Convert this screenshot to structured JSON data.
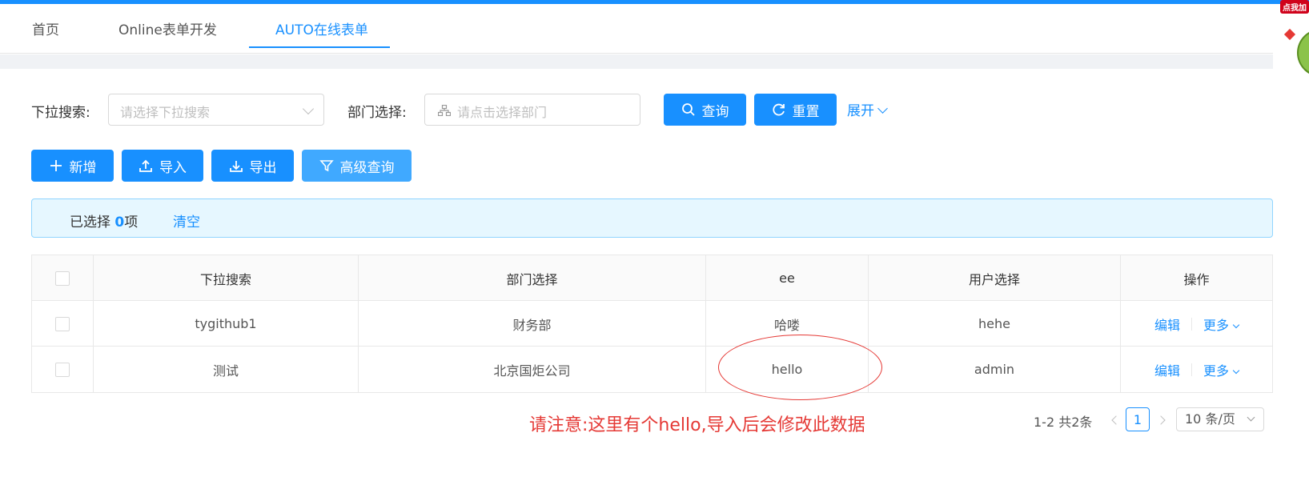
{
  "colors": {
    "primary": "#1890ff",
    "alert_bg": "#e6f7ff",
    "note_red": "#e53935"
  },
  "tabs": [
    {
      "label": "首页",
      "active": false
    },
    {
      "label": "Online表单开发",
      "active": false
    },
    {
      "label": "AUTO在线表单",
      "active": true
    }
  ],
  "search": {
    "dropdown_label": "下拉搜索:",
    "dropdown_placeholder": "请选择下拉搜索",
    "dept_label": "部门选择:",
    "dept_placeholder": "请点击选择部门",
    "query_button": "查询",
    "reset_button": "重置",
    "expand_link": "展开"
  },
  "toolbar": {
    "add": "新增",
    "import": "导入",
    "export": "导出",
    "advanced_query": "高级查询"
  },
  "selection": {
    "prefix": "已选择",
    "count": "0",
    "suffix": "项",
    "clear": "清空"
  },
  "table": {
    "columns": [
      "下拉搜索",
      "部门选择",
      "ee",
      "用户选择",
      "操作"
    ],
    "rows": [
      {
        "dropdown": "tygithub1",
        "dept": "财务部",
        "ee": "哈喽",
        "user": "hehe",
        "edit": "编辑",
        "more": "更多"
      },
      {
        "dropdown": "测试",
        "dept": "北京国炬公司",
        "ee": "hello",
        "user": "admin",
        "edit": "编辑",
        "more": "更多"
      }
    ]
  },
  "annotation": {
    "note": "请注意:这里有个hello,导入后会修改此数据"
  },
  "pagination": {
    "total": "1-2 共2条",
    "current_page": "1",
    "page_size": "10 条/页"
  },
  "float_widget": {
    "badge": "点我加"
  }
}
